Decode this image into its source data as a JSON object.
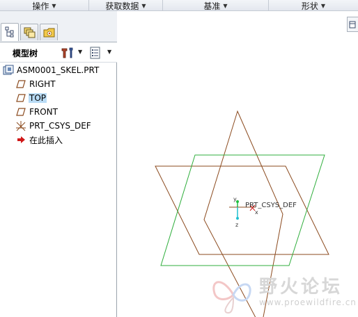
{
  "ribbon": {
    "groups": [
      {
        "label": "操作"
      },
      {
        "label": "获取数据"
      },
      {
        "label": "基准"
      },
      {
        "label": "形状"
      }
    ]
  },
  "panel": {
    "title": "模型树",
    "tabs": [
      {
        "icon": "model-tree-icon"
      },
      {
        "icon": "layers-icon"
      },
      {
        "icon": "folder-star-icon"
      }
    ]
  },
  "tree": {
    "items": [
      {
        "label": "ASM0001_SKEL.PRT",
        "icon": "part-icon",
        "selected": false
      },
      {
        "label": "RIGHT",
        "icon": "datum-plane-icon",
        "selected": false
      },
      {
        "label": "TOP",
        "icon": "datum-plane-icon",
        "selected": true
      },
      {
        "label": "FRONT",
        "icon": "datum-plane-icon",
        "selected": false
      },
      {
        "label": "PRT_CSYS_DEF",
        "icon": "coordinate-system-icon",
        "selected": false
      },
      {
        "label": "在此插入",
        "icon": "insert-here-arrow-icon",
        "selected": false
      }
    ]
  },
  "viewport": {
    "csys_label": "PRT_CSYS_DEF",
    "axis_x": "x",
    "axis_y": "y",
    "axis_z": "z",
    "colors": {
      "datum_brown": "#8b4a1e",
      "datum_green": "#2fae3c",
      "axis_red": "#d02020",
      "axis_green": "#20c040",
      "axis_cyan": "#20c0d0"
    }
  },
  "watermark": {
    "title": "野火论坛",
    "url": "www.proewildfire.cn"
  }
}
